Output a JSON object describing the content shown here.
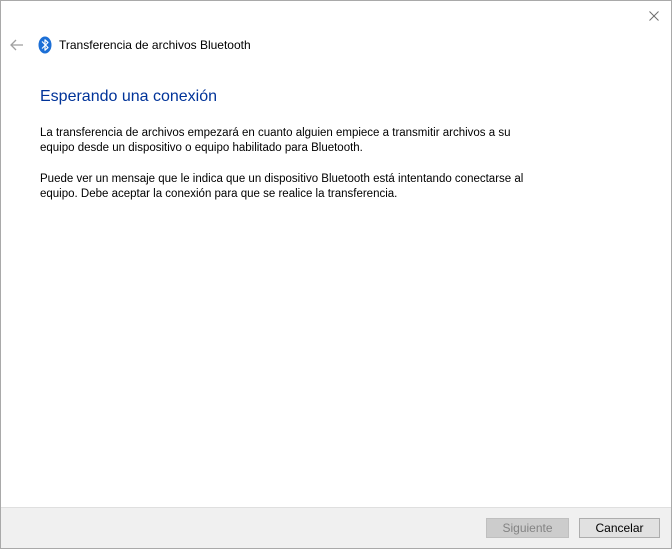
{
  "window": {
    "title": "Transferencia de archivos Bluetooth",
    "close_icon": "close-icon",
    "back_icon": "back-arrow-icon",
    "app_icon": "bluetooth-icon",
    "accent_color": "#003399"
  },
  "main": {
    "heading": "Esperando una conexión",
    "paragraph_1_line_1": "La transferencia de archivos empezará en cuanto alguien empiece a transmitir archivos a su",
    "paragraph_1_line_2": "equipo desde un dispositivo o equipo habilitado para Bluetooth.",
    "paragraph_2_line_1": "Puede ver un mensaje que le indica que un dispositivo Bluetooth está intentando conectarse al",
    "paragraph_2_line_2": "equipo. Debe aceptar la conexión para que se realice la transferencia."
  },
  "footer": {
    "next_label": "Siguiente",
    "next_disabled": true,
    "cancel_label": "Cancelar"
  }
}
